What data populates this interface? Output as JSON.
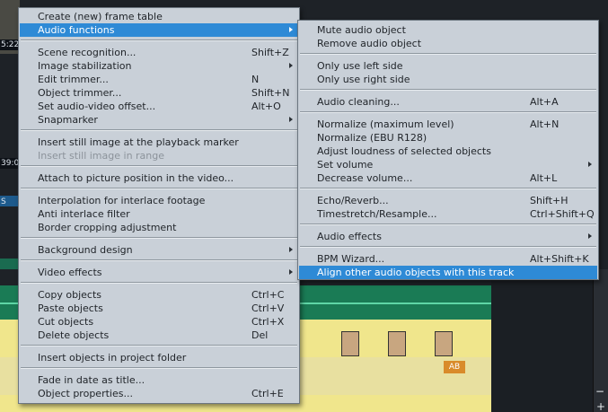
{
  "background": {
    "timecodes": [
      "5:22",
      "39:0"
    ],
    "track_label": "S",
    "badge": "AB",
    "scroll_plus": "+",
    "scroll_minus": "−"
  },
  "main_menu": {
    "items": {
      "create_frame_table": "Create (new) frame table",
      "audio_functions": "Audio functions",
      "scene_recognition": "Scene recognition...",
      "scene_recognition_sc": "Shift+Z",
      "image_stabilization": "Image stabilization",
      "edit_trimmer": "Edit trimmer...",
      "edit_trimmer_sc": "N",
      "object_trimmer": "Object trimmer...",
      "object_trimmer_sc": "Shift+N",
      "set_av_offset": "Set audio-video offset...",
      "set_av_offset_sc": "Alt+O",
      "snapmarker": "Snapmarker",
      "insert_still_marker": "Insert still image at the playback marker",
      "insert_still_range": "Insert still image in range",
      "attach_picture": "Attach to picture position in the video...",
      "interpolation": "Interpolation for interlace footage",
      "anti_interlace": "Anti interlace filter",
      "border_cropping": "Border cropping adjustment",
      "background_design": "Background design",
      "video_effects": "Video effects",
      "copy_objects": "Copy objects",
      "copy_objects_sc": "Ctrl+C",
      "paste_objects": "Paste objects",
      "paste_objects_sc": "Ctrl+V",
      "cut_objects": "Cut objects",
      "cut_objects_sc": "Ctrl+X",
      "delete_objects": "Delete objects",
      "delete_objects_sc": "Del",
      "insert_project_folder": "Insert objects in project folder",
      "fade_in_date": "Fade in date as title...",
      "object_properties": "Object properties...",
      "object_properties_sc": "Ctrl+E"
    }
  },
  "audio_submenu": {
    "items": {
      "mute": "Mute audio object",
      "remove": "Remove audio object",
      "left_side": "Only use left side",
      "right_side": "Only use right side",
      "audio_cleaning": "Audio cleaning...",
      "audio_cleaning_sc": "Alt+A",
      "normalize_max": "Normalize (maximum level)",
      "normalize_max_sc": "Alt+N",
      "normalize_ebu": "Normalize (EBU R128)",
      "adjust_loudness": "Adjust loudness of selected objects",
      "set_volume": "Set volume",
      "decrease_volume": "Decrease volume...",
      "decrease_volume_sc": "Alt+L",
      "echo_reverb": "Echo/Reverb...",
      "echo_reverb_sc": "Shift+H",
      "timestretch": "Timestretch/Resample...",
      "timestretch_sc": "Ctrl+Shift+Q",
      "audio_effects": "Audio effects",
      "bpm_wizard": "BPM Wizard...",
      "bpm_wizard_sc": "Alt+Shift+K",
      "align_audio": "Align other audio objects with this track"
    }
  },
  "colors": {
    "menu_bg": "#c9d0d8",
    "highlight": "#2e8ad6",
    "disabled_text": "#8c939b",
    "waveform": "#1a7b55",
    "strip": "#f0e68c"
  }
}
